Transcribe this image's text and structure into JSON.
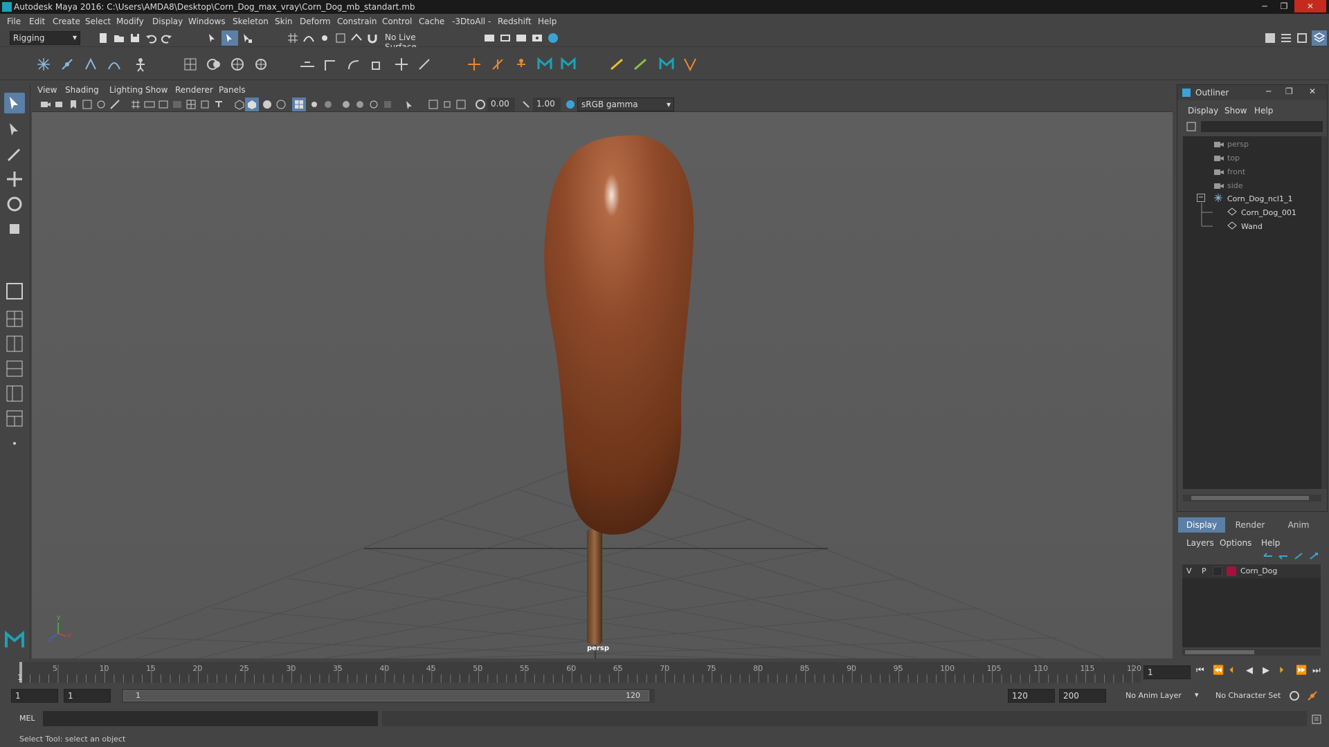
{
  "window": {
    "title": "Autodesk Maya 2016: C:\\Users\\AMDA8\\Desktop\\Corn_Dog_max_vray\\Corn_Dog_mb_standart.mb",
    "min_glyph": "─",
    "max_glyph": "❐",
    "close_glyph": "✕"
  },
  "menubar": {
    "items": [
      "File",
      "Edit",
      "Create",
      "Select",
      "Modify",
      "Display",
      "Windows",
      "Skeleton",
      "Skin",
      "Deform",
      "Constrain",
      "Control",
      "Cache",
      "-3DtoAll -",
      "Redshift",
      "Help"
    ]
  },
  "statusline": {
    "menuset": "Rigging",
    "live_surface": "No Live Surface"
  },
  "panel": {
    "menus": [
      "View",
      "Shading",
      "Lighting",
      "Show",
      "Renderer",
      "Panels"
    ],
    "exposure": "0.00",
    "gamma": "1.00",
    "colorspace": "sRGB gamma",
    "camera_label": "persp",
    "axis_x": "x",
    "axis_y": "y",
    "axis_z": "z"
  },
  "outliner": {
    "title": "Outliner",
    "menus": [
      "Display",
      "Show",
      "Help"
    ],
    "items": [
      {
        "label": "persp",
        "dim": true
      },
      {
        "label": "top",
        "dim": true
      },
      {
        "label": "front",
        "dim": true
      },
      {
        "label": "side",
        "dim": true
      },
      {
        "label": "Corn_Dog_ncl1_1",
        "dim": false
      },
      {
        "label": "Corn_Dog_001",
        "dim": false
      },
      {
        "label": "Wand",
        "dim": false
      }
    ],
    "collapse_glyph": "−"
  },
  "layers": {
    "tabs": [
      "Display",
      "Render",
      "Anim"
    ],
    "menus": [
      "Layers",
      "Options",
      "Help"
    ],
    "layer": {
      "v": "V",
      "p": "P",
      "name": "Corn_Dog",
      "color": "#a3123a"
    }
  },
  "timeline": {
    "ticks": [
      5,
      10,
      15,
      20,
      25,
      30,
      35,
      40,
      45,
      50,
      55,
      60,
      65,
      70,
      75,
      80,
      85,
      90,
      95,
      100,
      105,
      110,
      115,
      120
    ],
    "start_label": "1",
    "current_frame": "1",
    "playback_glyphs": [
      "⏮",
      "⏪",
      "⏴",
      "◀",
      "▶",
      "⏵",
      "⏩",
      "⏭"
    ]
  },
  "range": {
    "start": "1",
    "playback_start": "1",
    "slider_start": "1",
    "slider_end": "120",
    "playback_end": "120",
    "end": "200",
    "anim_layer": "No Anim Layer",
    "char_set": "No Character Set"
  },
  "command": {
    "lang": "MEL"
  },
  "help": {
    "text": "Select Tool: select an object"
  },
  "colors": {
    "accent": "#1aa3b8",
    "active_tool": "#5b7fa6",
    "viewport_bg": "#5b5b5b"
  }
}
